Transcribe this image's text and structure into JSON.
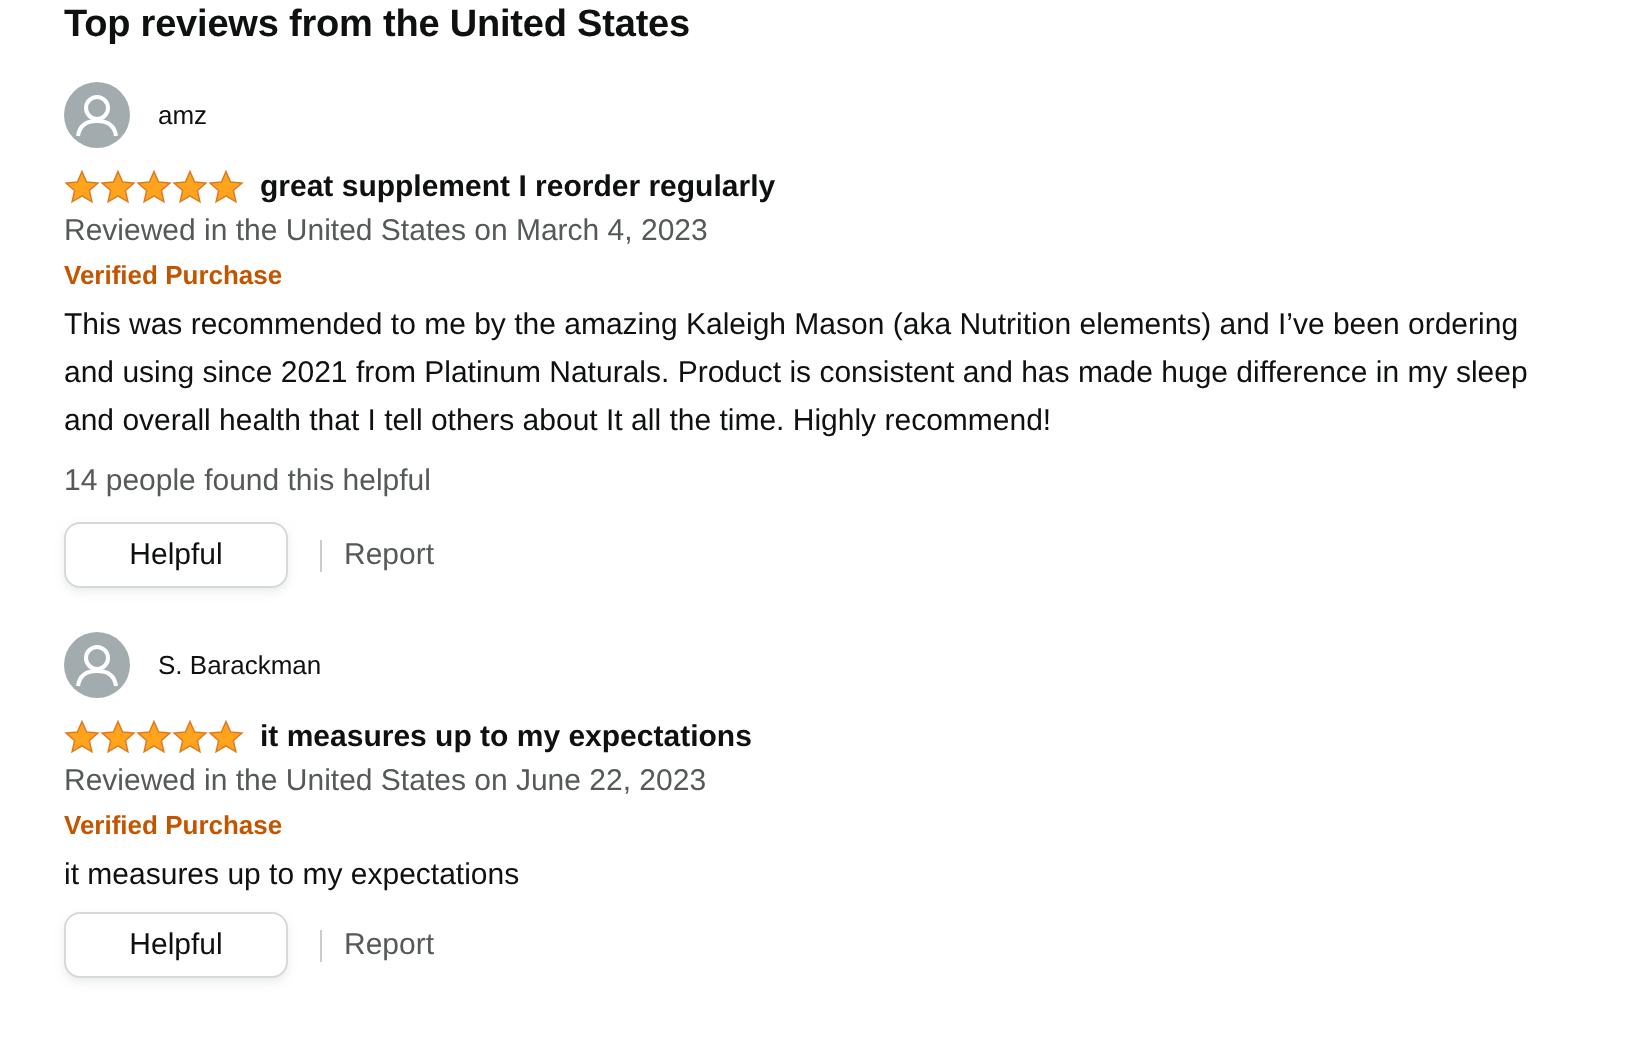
{
  "heading": "Top reviews from the United States",
  "reviews": [
    {
      "author": "amz",
      "stars": 5,
      "title": "great supplement I reorder regularly",
      "date": "Reviewed in the United States on March 4, 2023",
      "badge": "Verified Purchase",
      "body": "This was recommended to me by the amazing Kaleigh Mason (aka Nutrition elements) and I’ve been ordering and using since 2021 from Platinum Naturals. Product is consistent and has made huge difference in my sleep and overall health that I tell others about It all the time. Highly recommend!",
      "helpful_count": "14 people found this helpful",
      "helpful_button": "Helpful",
      "report_link": "Report"
    },
    {
      "author": "S. Barackman",
      "stars": 5,
      "title": "it measures up to my expectations",
      "date": "Reviewed in the United States on June 22, 2023",
      "badge": "Verified Purchase",
      "body": "it measures up to my expectations",
      "helpful_button": "Helpful",
      "report_link": "Report"
    }
  ]
}
